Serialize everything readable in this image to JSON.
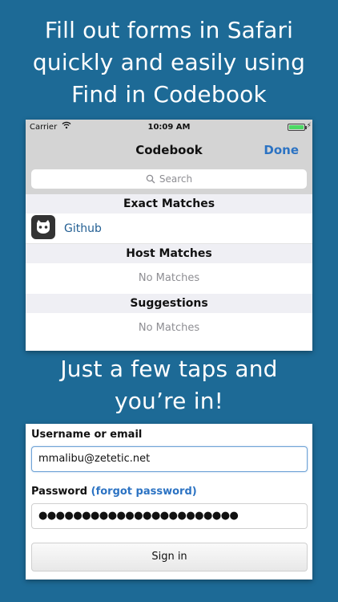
{
  "headline_top": [
    "Fill out forms in Safari",
    "quickly and easily using",
    "Find in Codebook"
  ],
  "headline_bottom": [
    "Just a few taps and",
    "you’re in!"
  ],
  "status_bar": {
    "carrier": "Carrier",
    "time": "10:09 AM",
    "battery_level": 1.0
  },
  "nav": {
    "title": "Codebook",
    "done_label": "Done"
  },
  "search": {
    "placeholder": "Search"
  },
  "sections": {
    "exact": {
      "header": "Exact Matches",
      "item": "Github"
    },
    "host": {
      "header": "Host Matches",
      "empty": "No Matches"
    },
    "suggestions": {
      "header": "Suggestions",
      "empty": "No Matches"
    }
  },
  "form": {
    "username_label": "Username or email",
    "username_value": "mmalibu@zetetic.net",
    "password_label": "Password",
    "forgot_label": "(forgot password)",
    "password_mask": "●●●●●●●●●●●●●●●●●●●●●●●",
    "signin_label": "Sign in"
  },
  "colors": {
    "background": "#1d6a96",
    "accent": "#2c73c3"
  },
  "icons": {
    "search": "search-icon",
    "wifi": "wifi-icon",
    "battery": "battery-icon",
    "github": "github-icon"
  }
}
